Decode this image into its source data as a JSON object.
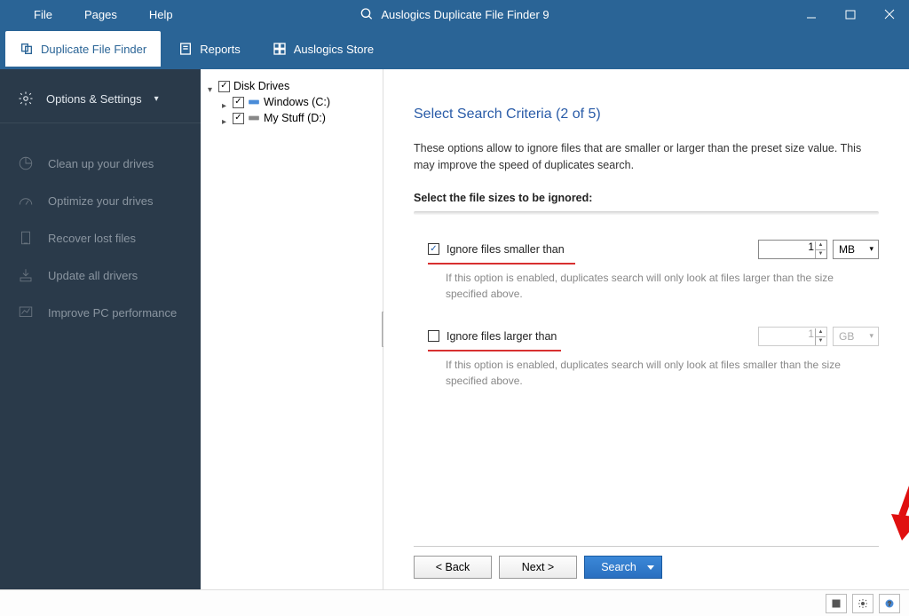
{
  "menu": {
    "file": "File",
    "pages": "Pages",
    "help": "Help"
  },
  "app_title": "Auslogics Duplicate File Finder 9",
  "tabs": {
    "dff": "Duplicate File Finder",
    "reports": "Reports",
    "store": "Auslogics Store"
  },
  "sidebar": {
    "options": "Options & Settings",
    "items": [
      "Clean up your drives",
      "Optimize your drives",
      "Recover lost files",
      "Update all drivers",
      "Improve PC performance"
    ]
  },
  "tree": {
    "root": "Disk Drives",
    "drives": [
      "Windows (C:)",
      "My Stuff (D:)"
    ]
  },
  "page": {
    "title": "Select Search Criteria (2 of 5)",
    "desc": "These options allow to ignore files that are smaller or larger than the preset size value. This may improve the speed of duplicates search.",
    "section": "Select the file sizes to be ignored:",
    "smaller_label": "Ignore files smaller than",
    "smaller_value": "1",
    "smaller_unit": "MB",
    "smaller_help": "If this option is enabled, duplicates search will only look at files larger than the size specified above.",
    "larger_label": "Ignore files larger than",
    "larger_value": "1",
    "larger_unit": "GB",
    "larger_help": "If this option is enabled, duplicates search will only look at files smaller than the size specified above."
  },
  "buttons": {
    "back": "< Back",
    "next": "Next >",
    "search": "Search"
  }
}
